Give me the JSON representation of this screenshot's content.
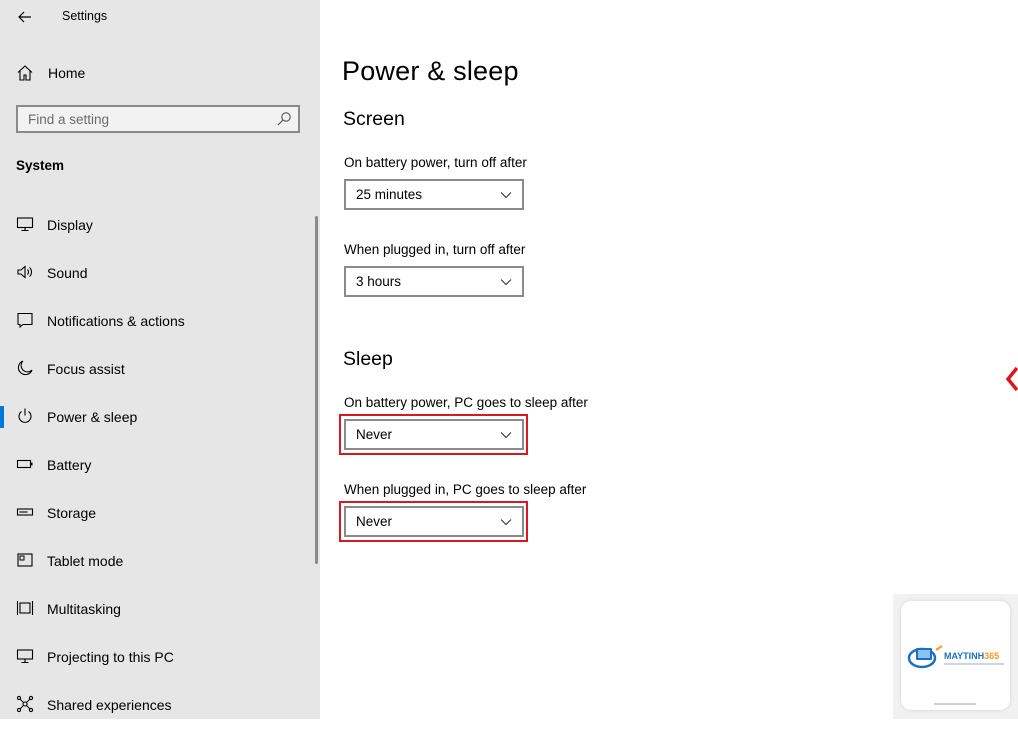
{
  "window": {
    "title": "Settings"
  },
  "sidebar": {
    "home_label": "Home",
    "search_placeholder": "Find a setting",
    "section_label": "System",
    "items": [
      {
        "label": "Display",
        "icon": "monitor-icon",
        "active": false
      },
      {
        "label": "Sound",
        "icon": "speaker-icon",
        "active": false
      },
      {
        "label": "Notifications & actions",
        "icon": "notification-icon",
        "active": false
      },
      {
        "label": "Focus assist",
        "icon": "moon-icon",
        "active": false
      },
      {
        "label": "Power & sleep",
        "icon": "power-icon",
        "active": true
      },
      {
        "label": "Battery",
        "icon": "battery-icon",
        "active": false
      },
      {
        "label": "Storage",
        "icon": "storage-icon",
        "active": false
      },
      {
        "label": "Tablet mode",
        "icon": "tablet-icon",
        "active": false
      },
      {
        "label": "Multitasking",
        "icon": "multitasking-icon",
        "active": false
      },
      {
        "label": "Projecting to this PC",
        "icon": "projecting-icon",
        "active": false
      },
      {
        "label": "Shared experiences",
        "icon": "shared-icon",
        "active": false
      }
    ]
  },
  "main": {
    "title": "Power & sleep",
    "screen": {
      "heading": "Screen",
      "battery_label": "On battery power, turn off after",
      "battery_value": "25 minutes",
      "plugged_label": "When plugged in, turn off after",
      "plugged_value": "3 hours"
    },
    "sleep": {
      "heading": "Sleep",
      "battery_label": "On battery power, PC goes to sleep after",
      "battery_value": "Never",
      "plugged_label": "When plugged in, PC goes to sleep after",
      "plugged_value": "Never"
    }
  },
  "watermark": {
    "brand_main": "MAYTINH",
    "brand_accent": "365"
  },
  "colors": {
    "accent": "#0078d7",
    "highlight": "#d71920",
    "sidebar_bg": "#e6e6e6"
  }
}
